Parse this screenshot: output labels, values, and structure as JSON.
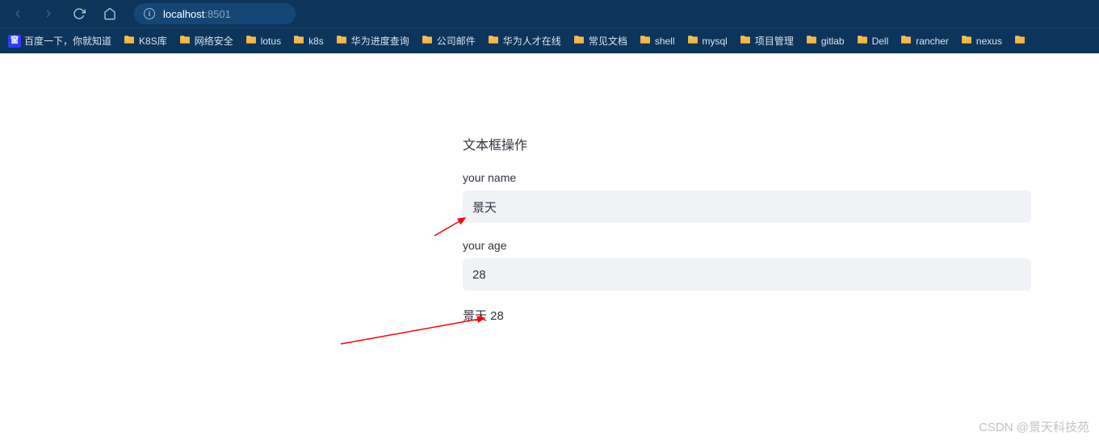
{
  "browser": {
    "url_host": "localhost",
    "url_port": ":8501"
  },
  "bookmarks": [
    {
      "label": "百度一下，你就知道",
      "icon": "baidu"
    },
    {
      "label": "K8S库",
      "icon": "folder"
    },
    {
      "label": "网络安全",
      "icon": "folder"
    },
    {
      "label": "lotus",
      "icon": "folder"
    },
    {
      "label": "k8s",
      "icon": "folder"
    },
    {
      "label": "华为进度查询",
      "icon": "folder"
    },
    {
      "label": "公司邮件",
      "icon": "folder"
    },
    {
      "label": "华为人才在线",
      "icon": "folder"
    },
    {
      "label": "常见文档",
      "icon": "folder"
    },
    {
      "label": "shell",
      "icon": "folder"
    },
    {
      "label": "mysql",
      "icon": "folder"
    },
    {
      "label": "项目管理",
      "icon": "folder"
    },
    {
      "label": "gitlab",
      "icon": "folder"
    },
    {
      "label": "Dell",
      "icon": "folder"
    },
    {
      "label": "rancher",
      "icon": "folder"
    },
    {
      "label": "nexus",
      "icon": "folder"
    },
    {
      "label": "",
      "icon": "folder"
    }
  ],
  "page": {
    "title": "文本框操作",
    "name_label": "your name",
    "name_value": "景天",
    "age_label": "your age",
    "age_value": "28",
    "output": "景天 28"
  },
  "watermark": "CSDN @景天科技苑"
}
